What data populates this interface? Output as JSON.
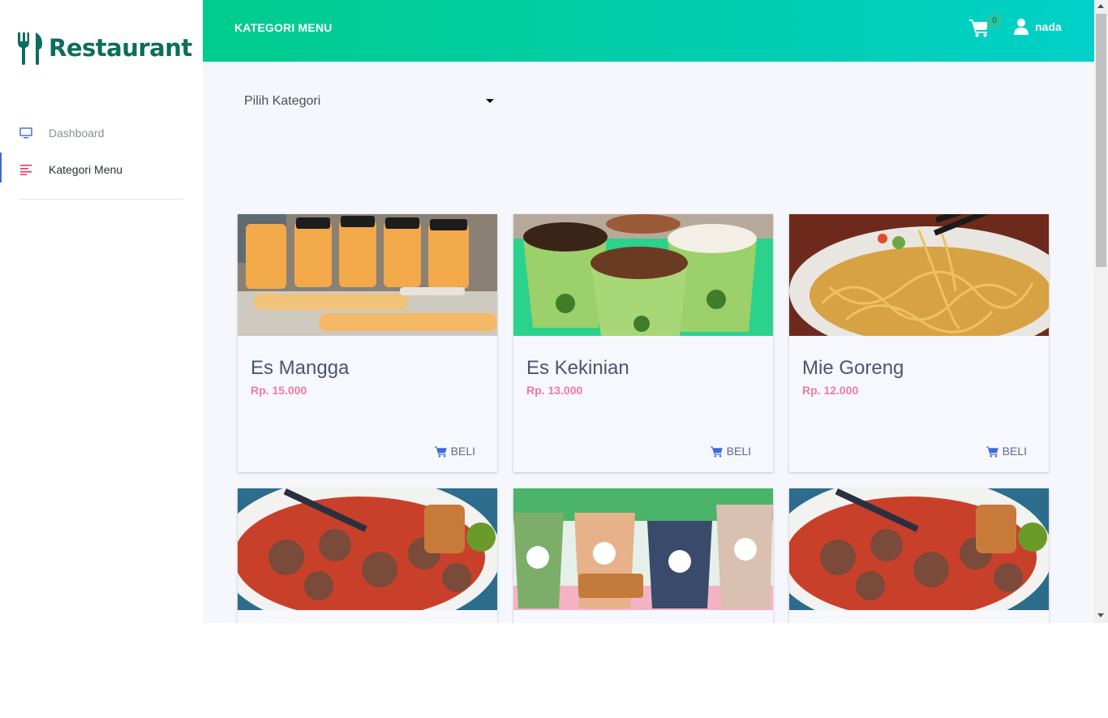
{
  "brand": {
    "name": "Restaurant",
    "color": "#0c6d5d"
  },
  "sidebar": {
    "items": [
      {
        "label": "Dashboard",
        "icon": "monitor-icon",
        "active": false
      },
      {
        "label": "Kategori Menu",
        "icon": "menu-lines-icon",
        "active": true
      }
    ]
  },
  "header": {
    "title": "KATEGORI MENU",
    "cart_count": "0",
    "user_name": "nada",
    "gradient": [
      "#00cc8c",
      "#00d0c8"
    ]
  },
  "filter": {
    "selected": "Pilih Kategori"
  },
  "products": [
    {
      "name": "Es Mangga",
      "price": "Rp. 15.000",
      "buy_label": "BELI",
      "image": "mango-drink-bottles"
    },
    {
      "name": "Es Kekinian",
      "price": "Rp. 13.000",
      "buy_label": "BELI",
      "image": "green-iced-drinks"
    },
    {
      "name": "Mie Goreng",
      "price": "Rp. 12.000",
      "buy_label": "BELI",
      "image": "fried-noodles"
    },
    {
      "name": "",
      "price": "",
      "buy_label": "",
      "image": "meatball-soup"
    },
    {
      "name": "",
      "price": "",
      "buy_label": "",
      "image": "boba-drinks"
    },
    {
      "name": "",
      "price": "",
      "buy_label": "",
      "image": "meatball-soup"
    }
  ],
  "colors": {
    "accent": "#3f6ad8",
    "price": "#ef7aa2",
    "title_text": "#4a5672"
  }
}
